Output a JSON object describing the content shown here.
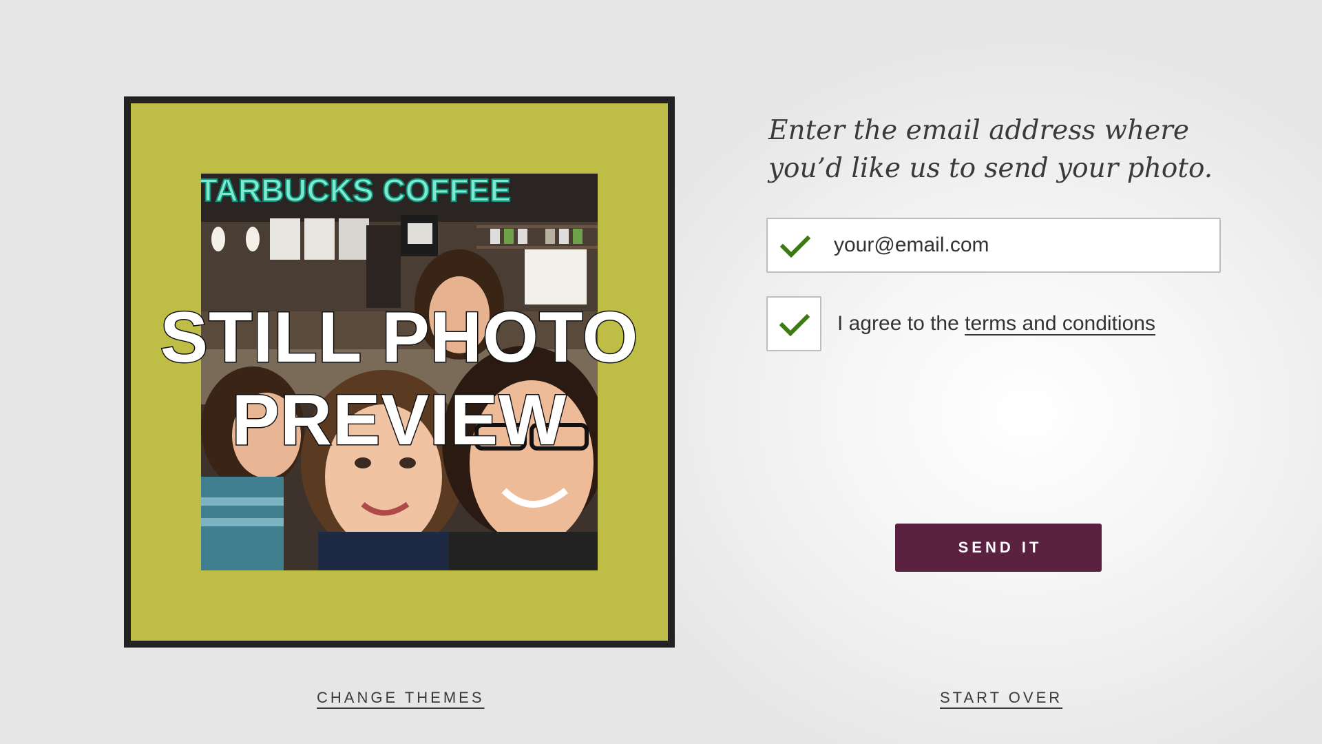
{
  "preview": {
    "overlay_line1": "STILL PHOTO",
    "overlay_line2": "PREVIEW",
    "photo_sign_text": "TARBUCKS COFFEE",
    "photo_description_icon": "photo-image",
    "theme_color": "#bebe46",
    "frame_color": "#222222"
  },
  "form": {
    "prompt": "Enter the email address where you’d like us to send your photo.",
    "email_placeholder": "your@email.com",
    "email_valid_icon": "checkmark-icon",
    "agree_checked": true,
    "agree_prefix": "I agree to the ",
    "agree_link": "terms and conditions",
    "send_label": "SEND IT",
    "send_color": "#5b2140",
    "check_color": "#3c7a12"
  },
  "footer": {
    "change_themes": "CHANGE THEMES",
    "start_over": "START OVER"
  }
}
